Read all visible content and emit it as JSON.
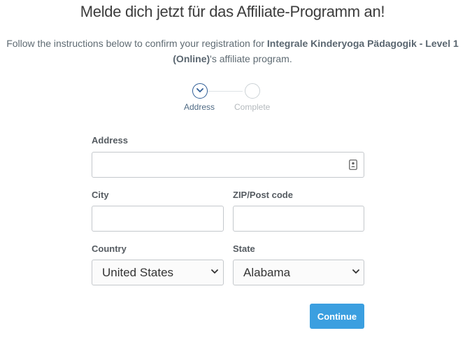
{
  "header": {
    "title": "Melde dich jetzt für das Affiliate-Programm an!",
    "intro_prefix": "Follow the instructions below to confirm your registration for ",
    "program_name": "Integrale Kinderyoga Pädagogik - Level 1 (Online)",
    "intro_suffix": "'s affiliate program."
  },
  "steps": [
    {
      "label": "Address",
      "state": "active"
    },
    {
      "label": "Complete",
      "state": "pending"
    }
  ],
  "form": {
    "address_label": "Address",
    "address_value": "",
    "city_label": "City",
    "city_value": "",
    "zip_label": "ZIP/Post code",
    "zip_value": "",
    "country_label": "Country",
    "country_selected": "United States",
    "state_label": "State",
    "state_selected": "Alabama",
    "continue_label": "Continue"
  },
  "colors": {
    "accent": "#3b9fe0",
    "step_active": "#2f5e97"
  },
  "icons": {
    "address_field": "contact-card-icon",
    "step_active": "chevron-down-icon",
    "select": "chevron-down-icon"
  }
}
